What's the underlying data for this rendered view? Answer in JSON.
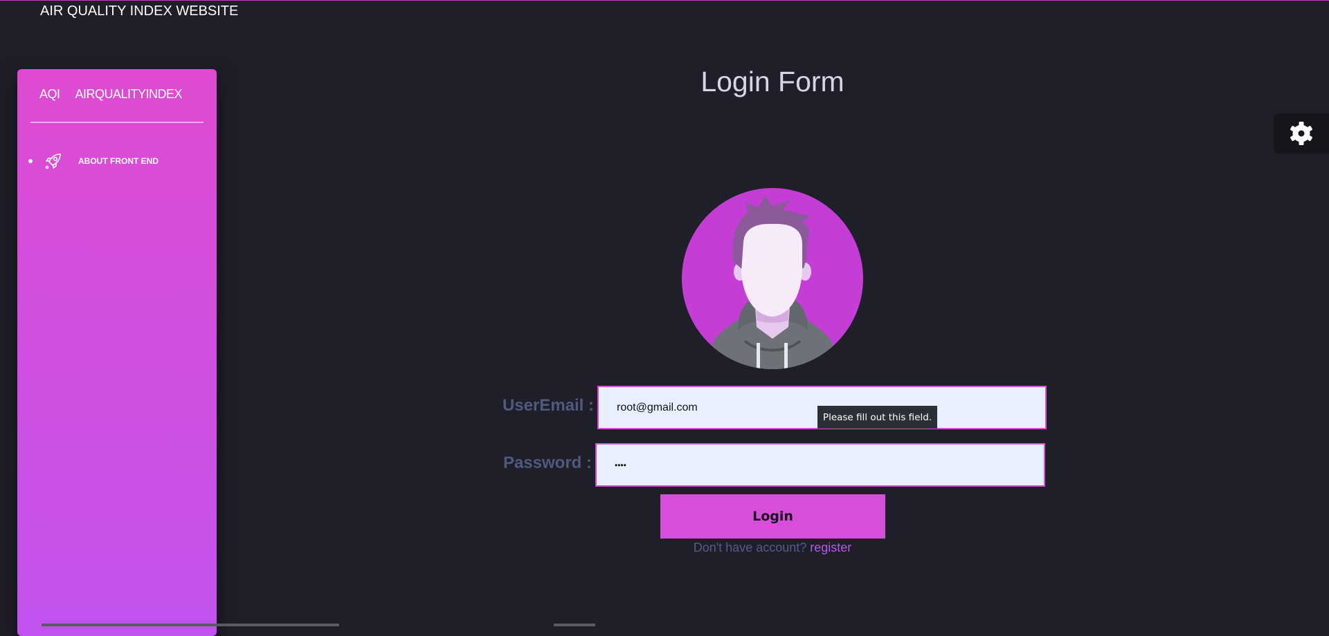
{
  "header": {
    "title": "AIR QUALITY INDEX WEBSITE"
  },
  "sidebar": {
    "brand_short": "AQI",
    "brand_long": "AIRQUALITYINDEX",
    "items": [
      {
        "label": "ABOUT FRONT END",
        "icon": "rocket-icon"
      }
    ]
  },
  "main": {
    "title": "Login Form",
    "settings_icon": "gear-icon"
  },
  "form": {
    "email_label": "UserEmail :",
    "email_value": "root@gmail.com",
    "password_label": "Password :",
    "password_value": "••••",
    "validation_tooltip": "Please fill out this field.",
    "login_label": "Login",
    "no_account_text": "Don't have account?",
    "register_link": "register"
  },
  "colors": {
    "accent": "#d74fd8",
    "sidebar_top": "#de4bd0",
    "sidebar_bottom": "#c152ee",
    "background": "#1f1f29",
    "input_bg": "#e8f0fe"
  }
}
